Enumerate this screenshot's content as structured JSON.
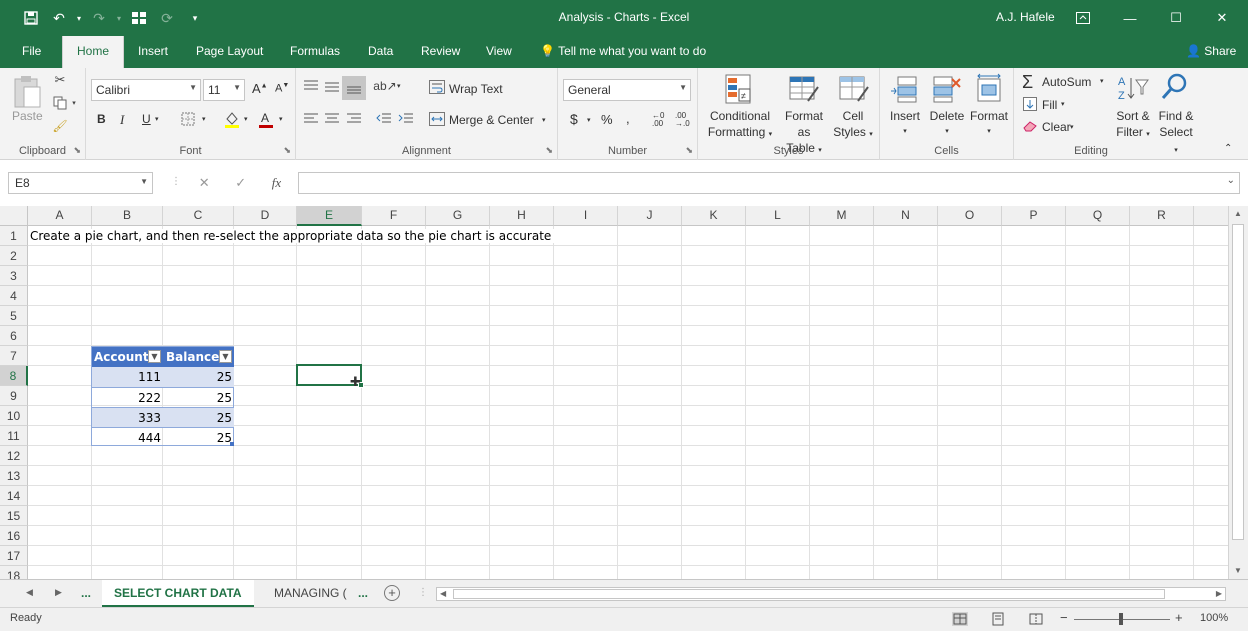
{
  "titlebar": {
    "title": "Analysis - Charts  -  Excel",
    "user": "A.J. Hafele"
  },
  "tabs": [
    "File",
    "Home",
    "Insert",
    "Page Layout",
    "Formulas",
    "Data",
    "Review",
    "View"
  ],
  "tellme": "Tell me what you want to do",
  "share": "Share",
  "ribbon": {
    "clipboard": {
      "label": "Clipboard",
      "paste": "Paste"
    },
    "font": {
      "label": "Font",
      "name": "Calibri",
      "size": "11"
    },
    "alignment": {
      "label": "Alignment",
      "wrap": "Wrap Text",
      "merge": "Merge & Center"
    },
    "number": {
      "label": "Number",
      "format": "General"
    },
    "styles": {
      "label": "Styles",
      "cond1": "Conditional",
      "cond2": "Formatting",
      "fmt1": "Format as",
      "fmt2": "Table",
      "cell1": "Cell",
      "cell2": "Styles"
    },
    "cells": {
      "label": "Cells",
      "insert": "Insert",
      "delete": "Delete",
      "format": "Format"
    },
    "editing": {
      "label": "Editing",
      "autosum": "AutoSum",
      "fill": "Fill",
      "clear": "Clear",
      "sort1": "Sort &",
      "sort2": "Filter",
      "find1": "Find &",
      "find2": "Select"
    }
  },
  "formula": {
    "namebox": "E8",
    "value": ""
  },
  "columns": [
    "A",
    "B",
    "C",
    "D",
    "E",
    "F",
    "G",
    "H",
    "I",
    "J",
    "K",
    "L",
    "M",
    "N",
    "O",
    "P",
    "Q",
    "R"
  ],
  "rows": [
    "1",
    "2",
    "3",
    "4",
    "5",
    "6",
    "7",
    "8",
    "9",
    "10",
    "11",
    "12",
    "13",
    "14",
    "15",
    "16",
    "17",
    "18"
  ],
  "cells": {
    "A1": "Create a pie chart, and then re-select the appropriate data so the pie chart is accurate"
  },
  "table": {
    "headers": [
      "Account",
      "Balance"
    ],
    "rows": [
      [
        "111",
        "25"
      ],
      [
        "222",
        "25"
      ],
      [
        "333",
        "25"
      ],
      [
        "444",
        "25"
      ]
    ]
  },
  "sheets": {
    "active": "SELECT CHART DATA",
    "other": "MANAGING (",
    "more": "..."
  },
  "status": {
    "ready": "Ready",
    "zoom": "100%"
  },
  "colors": {
    "brand": "#217346",
    "table_header": "#4472c4",
    "table_band": "#d9e1f2"
  }
}
